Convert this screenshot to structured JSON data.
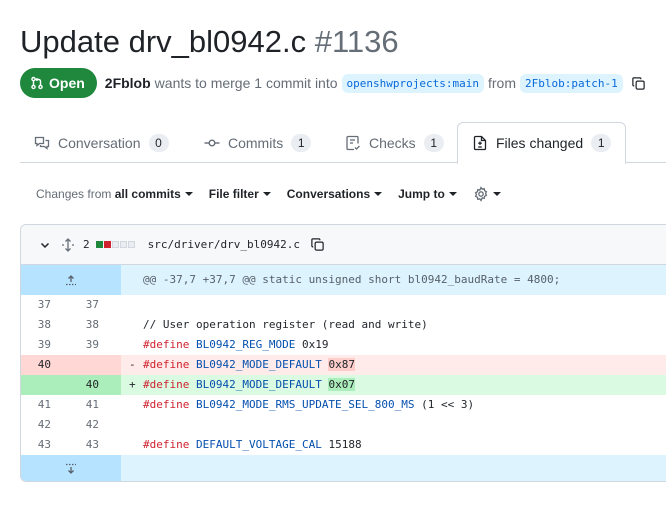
{
  "pr": {
    "title": "Update drv_bl0942.c",
    "number": "#1136",
    "state": "Open",
    "author": "2Fblob",
    "merge_text": "wants to merge 1 commit into",
    "base_branch": "openshwprojects:main",
    "from_text": "from",
    "head_branch": "2Fblob:patch-1"
  },
  "tabs": [
    {
      "label": "Conversation",
      "count": "0"
    },
    {
      "label": "Commits",
      "count": "1"
    },
    {
      "label": "Checks",
      "count": "1"
    },
    {
      "label": "Files changed",
      "count": "1"
    }
  ],
  "toolbar": {
    "changes_from": "Changes from",
    "all_commits": "all commits",
    "file_filter": "File filter",
    "conversations": "Conversations",
    "jump_to": "Jump to"
  },
  "file": {
    "changes": "2",
    "path": "src/driver/drv_bl0942.c"
  },
  "colors": {
    "open_green": "#1f883d",
    "branch_bg": "#ddf4ff",
    "branch_fg": "#0969da",
    "del_bg": "#ffebe9",
    "add_bg": "#dafbe1"
  },
  "diff": {
    "hunk": "@@ -37,7 +37,7 @@ static unsigned short bl0942_baudRate = 4800;",
    "lines": [
      {
        "old": "37",
        "new": "37",
        "type": "ctx",
        "marker": " ",
        "text": ""
      },
      {
        "old": "38",
        "new": "38",
        "type": "ctx",
        "marker": " ",
        "text": "// User operation register (read and write)"
      },
      {
        "old": "39",
        "new": "39",
        "type": "ctx",
        "marker": " ",
        "text": "#define BL0942_REG_MODE 0x19"
      },
      {
        "old": "40",
        "new": "",
        "type": "del",
        "marker": "-",
        "text": "#define BL0942_MODE_DEFAULT 0x87"
      },
      {
        "old": "",
        "new": "40",
        "type": "add",
        "marker": "+",
        "text": "#define BL0942_MODE_DEFAULT 0x07"
      },
      {
        "old": "41",
        "new": "41",
        "type": "ctx",
        "marker": " ",
        "text": "#define BL0942_MODE_RMS_UPDATE_SEL_800_MS (1 << 3)"
      },
      {
        "old": "42",
        "new": "42",
        "type": "ctx",
        "marker": " ",
        "text": ""
      },
      {
        "old": "43",
        "new": "43",
        "type": "ctx",
        "marker": " ",
        "text": "#define DEFAULT_VOLTAGE_CAL 15188"
      }
    ]
  }
}
